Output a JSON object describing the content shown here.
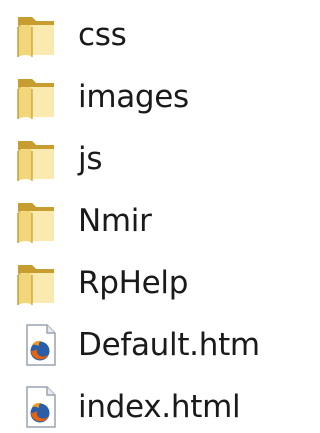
{
  "items": [
    {
      "label": "css",
      "type": "folder",
      "icon": "folder-icon"
    },
    {
      "label": "images",
      "type": "folder",
      "icon": "folder-icon"
    },
    {
      "label": "js",
      "type": "folder",
      "icon": "folder-icon"
    },
    {
      "label": "Nmir",
      "type": "folder",
      "icon": "folder-icon"
    },
    {
      "label": "RpHelp",
      "type": "folder",
      "icon": "folder-icon"
    },
    {
      "label": "Default.htm",
      "type": "html",
      "icon": "firefox-html-file-icon"
    },
    {
      "label": "index.html",
      "type": "html",
      "icon": "firefox-html-file-icon"
    }
  ],
  "colors": {
    "folder_back": "#d9b44a",
    "folder_front": "#f2d77a",
    "folder_highlight": "#fbeab0",
    "text": "#1a1a1a",
    "firefox_orange": "#e8630a",
    "firefox_blue": "#2a5ea8"
  }
}
